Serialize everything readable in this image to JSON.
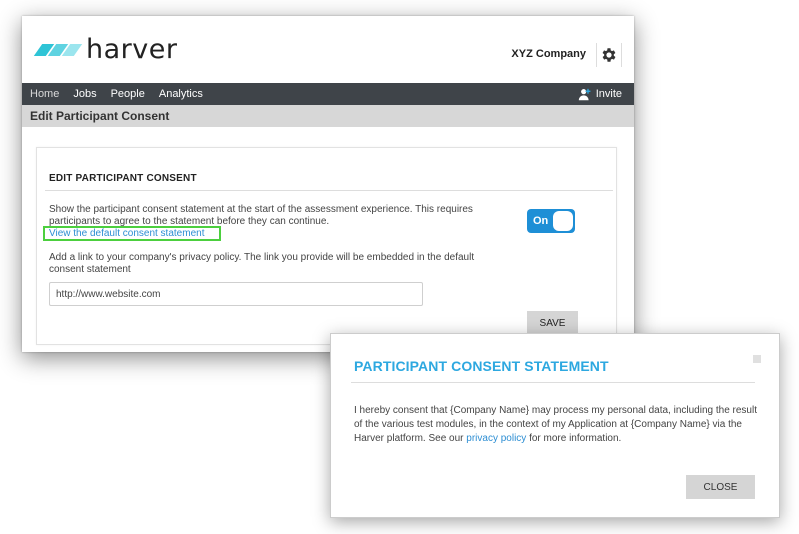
{
  "brand": {
    "logo_text": "harver"
  },
  "header": {
    "company": "XYZ Company"
  },
  "nav": {
    "items": [
      {
        "label": "Home"
      },
      {
        "label": "Jobs"
      },
      {
        "label": "People"
      },
      {
        "label": "Analytics"
      }
    ],
    "invite_label": "Invite"
  },
  "page": {
    "title": "Edit Participant Consent"
  },
  "panel": {
    "title": "EDIT PARTICIPANT CONSENT",
    "description": "Show the participant consent statement at the start of the assessment experience. This requires participants to agree to the statement before they can continue.",
    "link_label": "View the default consent statement",
    "privacy_description": "Add a link to your company's privacy policy. The link you provide will be embedded in the default consent statement",
    "privacy_url": "http://www.website.com",
    "toggle_label": "On",
    "save_label": "SAVE"
  },
  "modal": {
    "title": "PARTICIPANT CONSENT STATEMENT",
    "body_before": "I hereby consent that {Company Name} may process my personal data, including the result of the various test modules, in the context of my Application at {Company Name} via the Harver platform. See our ",
    "body_link": "privacy policy",
    "body_after": " for more information.",
    "close_label": "CLOSE"
  },
  "colors": {
    "accent": "#2da8e0",
    "toggle_on": "#1e8fd6",
    "nav_bg": "#3f4449",
    "highlight_box": "#4ccf3e"
  }
}
